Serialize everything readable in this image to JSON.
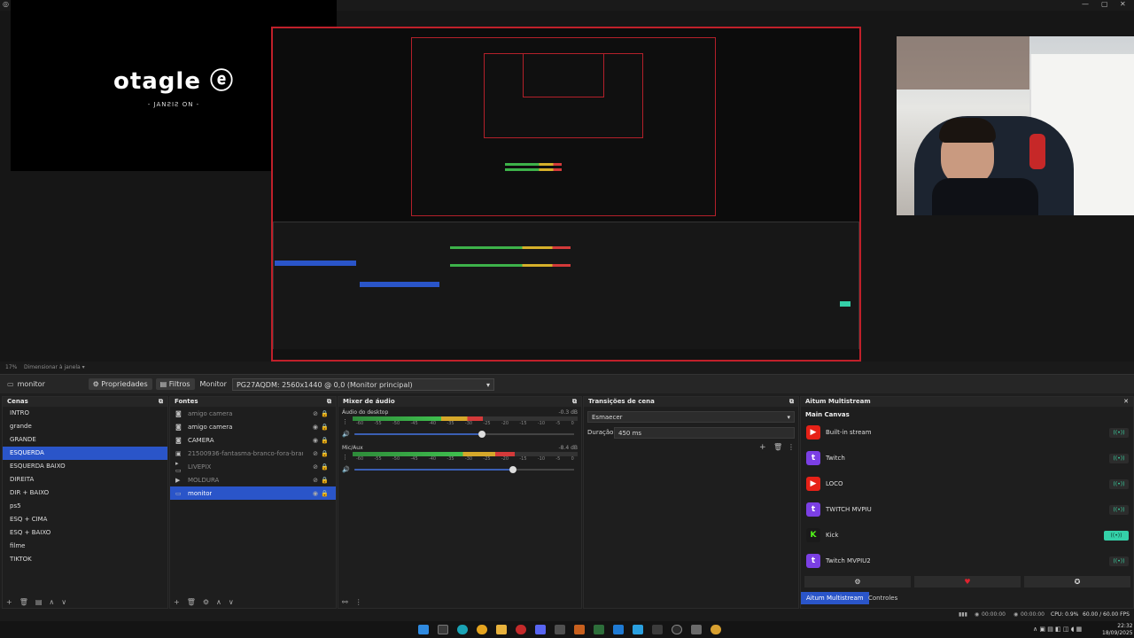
{
  "window": {
    "minimize": "—",
    "maximize": "▢",
    "close": "✕"
  },
  "preview": {
    "elgato_logo": "otagle ⓔ",
    "no_signal": "- JANƧIƧ ON -",
    "zoom": "17%",
    "fit": "Dimensionar à janela"
  },
  "source_toolbar": {
    "source_name": "monitor",
    "properties": "Propriedades",
    "filters": "Filtros",
    "monitor_label": "Monitor",
    "monitor_value": "PG27AQDM: 2560x1440 @ 0,0 (Monitor principal)"
  },
  "scenes": {
    "title": "Cenas",
    "items": [
      "INTRO",
      "grande",
      "GRANDE",
      "ESQUERDA",
      "ESQUERDA BAIXO",
      "DIREITA",
      "DIR + BAIXO",
      "ps5",
      "ESQ + CIMA",
      "ESQ + BAIXO",
      "filme",
      "TIKTOK"
    ],
    "active_index": 3
  },
  "sources": {
    "title": "Fontes",
    "items": [
      {
        "name": "amigo camera",
        "icon": "camera-icon",
        "dim": true
      },
      {
        "name": "amigo camera",
        "icon": "camera-icon",
        "dim": false
      },
      {
        "name": "CAMERA",
        "icon": "camera-icon",
        "dim": false
      },
      {
        "name": "21500936-fantasma-branco-fora-branco-cor-pc",
        "icon": "media-icon",
        "dim": true
      },
      {
        "name": "LIVEPIX",
        "icon": "folder-icon",
        "dim": true
      },
      {
        "name": "MOLDURA",
        "icon": "play-icon",
        "dim": true
      },
      {
        "name": "monitor",
        "icon": "monitor-icon",
        "dim": false
      }
    ],
    "active_index": 6
  },
  "mixer": {
    "title": "Mixer de áudio",
    "channels": [
      {
        "name": "Áudio do desktop",
        "db": "-0.3 dB",
        "level": 0.58
      },
      {
        "name": "Mic/Aux",
        "db": "-8.4 dB",
        "level": 0.72
      }
    ],
    "ticks": [
      "-60",
      "-55",
      "-50",
      "-45",
      "-40",
      "-35",
      "-30",
      "-25",
      "-20",
      "-15",
      "-10",
      "-5",
      "0"
    ]
  },
  "transitions": {
    "title": "Transições de cena",
    "type": "Esmaecer",
    "duration_label": "Duração",
    "duration_value": "450 ms"
  },
  "multistream": {
    "title": "Aitum Multistream",
    "canvas": "Main Canvas",
    "outputs": [
      {
        "name": "Built-in stream",
        "platform": "youtube",
        "color": "#e62117",
        "glyph": "▶",
        "live": false
      },
      {
        "name": "Twitch",
        "platform": "twitch",
        "color": "#7b3fe4",
        "glyph": "t",
        "live": false
      },
      {
        "name": "LOCO",
        "platform": "loco",
        "color": "#e62117",
        "glyph": "▶",
        "live": false
      },
      {
        "name": "TWITCH MVPIU",
        "platform": "twitch",
        "color": "#7b3fe4",
        "glyph": "t",
        "live": false
      },
      {
        "name": "Kick",
        "platform": "kick",
        "color": "#1a1a1a",
        "glyph": "K",
        "live": true
      },
      {
        "name": "Twitch MVPIU2",
        "platform": "twitch",
        "color": "#7b3fe4",
        "glyph": "t",
        "live": false
      }
    ],
    "tab_active": "Aitum Multistream",
    "tab_other": "Controles"
  },
  "status": {
    "t1": "00:00:00",
    "t2": "00:00:00",
    "cpu": "CPU: 0.9%",
    "fps": "60.00 / 60.00 FPS"
  },
  "clock": {
    "time": "22:32",
    "date": "18/09/2025"
  }
}
